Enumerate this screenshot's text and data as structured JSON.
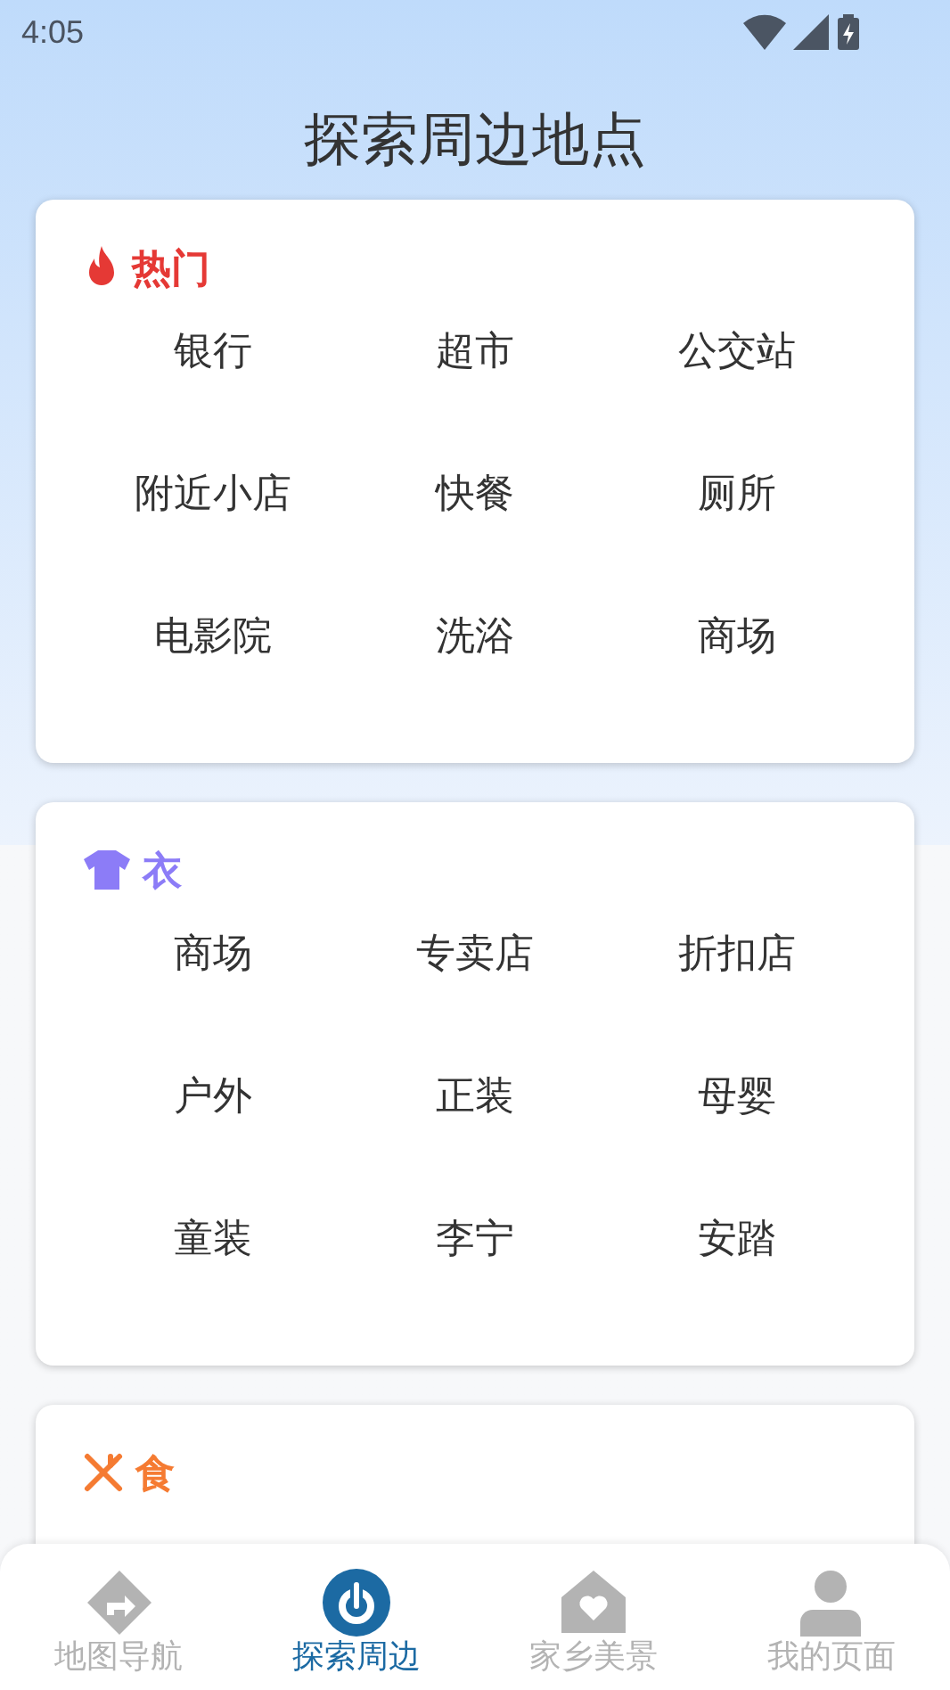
{
  "status_bar": {
    "time": "4:05"
  },
  "title": "探索周边地点",
  "categories": [
    {
      "kind": "hot",
      "name": "热门",
      "color": "#e53935",
      "items": [
        "银行",
        "超市",
        "公交站",
        "附近小店",
        "快餐",
        "厕所",
        "电影院",
        "洗浴",
        "商场"
      ]
    },
    {
      "kind": "clothes",
      "name": "衣",
      "color": "#8c7cf7",
      "items": [
        "商场",
        "专卖店",
        "折扣店",
        "户外",
        "正装",
        "母婴",
        "童装",
        "李宁",
        "安踏"
      ]
    },
    {
      "kind": "food",
      "name": "食",
      "color": "#f57b32"
    }
  ],
  "nav": [
    {
      "kind": "navigation",
      "label": "地图导航",
      "selected": false
    },
    {
      "kind": "explore",
      "label": "探索周边",
      "selected": true
    },
    {
      "kind": "hometown",
      "label": "家乡美景",
      "selected": false
    },
    {
      "kind": "profile",
      "label": "我的页面",
      "selected": false
    }
  ]
}
